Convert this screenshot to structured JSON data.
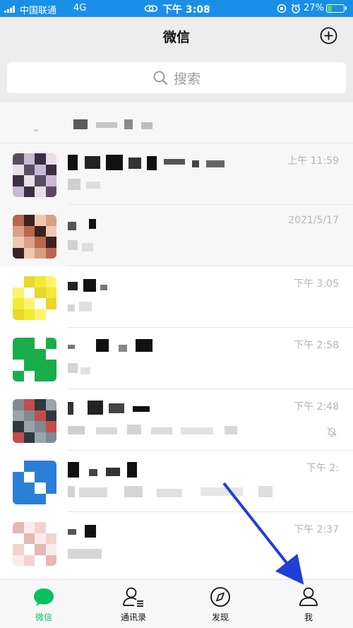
{
  "status_bar": {
    "carrier": "中国联通",
    "network": "4G",
    "time": "下午 3:08",
    "battery_pct": "27%",
    "battery_level": 0.27
  },
  "header": {
    "title": "微信",
    "add_icon": "plus-circle-icon"
  },
  "search": {
    "placeholder": "搜索",
    "icon": "search-icon"
  },
  "chats": [
    {
      "time": "上午 11:59",
      "avatar_colors": [
        "#5c4a63",
        "#c9b9d6",
        "#3d2f3f",
        "#e8dfe9"
      ]
    },
    {
      "time": "2021/5/17",
      "avatar_colors": [
        "#d9a088",
        "#b8684e",
        "#3a2320",
        "#f0c8b0"
      ]
    },
    {
      "time": "下午 3:05",
      "avatar_colors": [
        "#f3ea35",
        "#fff36b",
        "#ffffff",
        "#e8d82a"
      ]
    },
    {
      "time": "下午 2:58",
      "avatar_colors": [
        "#1aad4b",
        "#ffffff",
        "#1aad4b",
        "#1aad4b"
      ]
    },
    {
      "time": "下午 2:48",
      "muted": true,
      "avatar_colors": [
        "#7f8a91",
        "#c44c4c",
        "#2f3a40",
        "#9aa4aa"
      ]
    },
    {
      "time": "下午 2:",
      "avatar_colors": [
        "#2b7fd6",
        "#ffffff",
        "#2b7fd6",
        "#2b7fd6"
      ]
    },
    {
      "time": "下午 2:37",
      "avatar_colors": [
        "#f2d2cf",
        "#ffffff",
        "#e6b7b3",
        "#fbeceb"
      ]
    }
  ],
  "tabs": [
    {
      "label": "微信",
      "icon": "chat-bubble-icon",
      "active": true
    },
    {
      "label": "通讯录",
      "icon": "contacts-icon",
      "active": false
    },
    {
      "label": "发现",
      "icon": "compass-icon",
      "active": false
    },
    {
      "label": "我",
      "icon": "person-icon",
      "active": false
    }
  ],
  "colors": {
    "accent": "#07c160",
    "status_bar": "#1a8fe8",
    "arrow": "#1f3fd6"
  }
}
